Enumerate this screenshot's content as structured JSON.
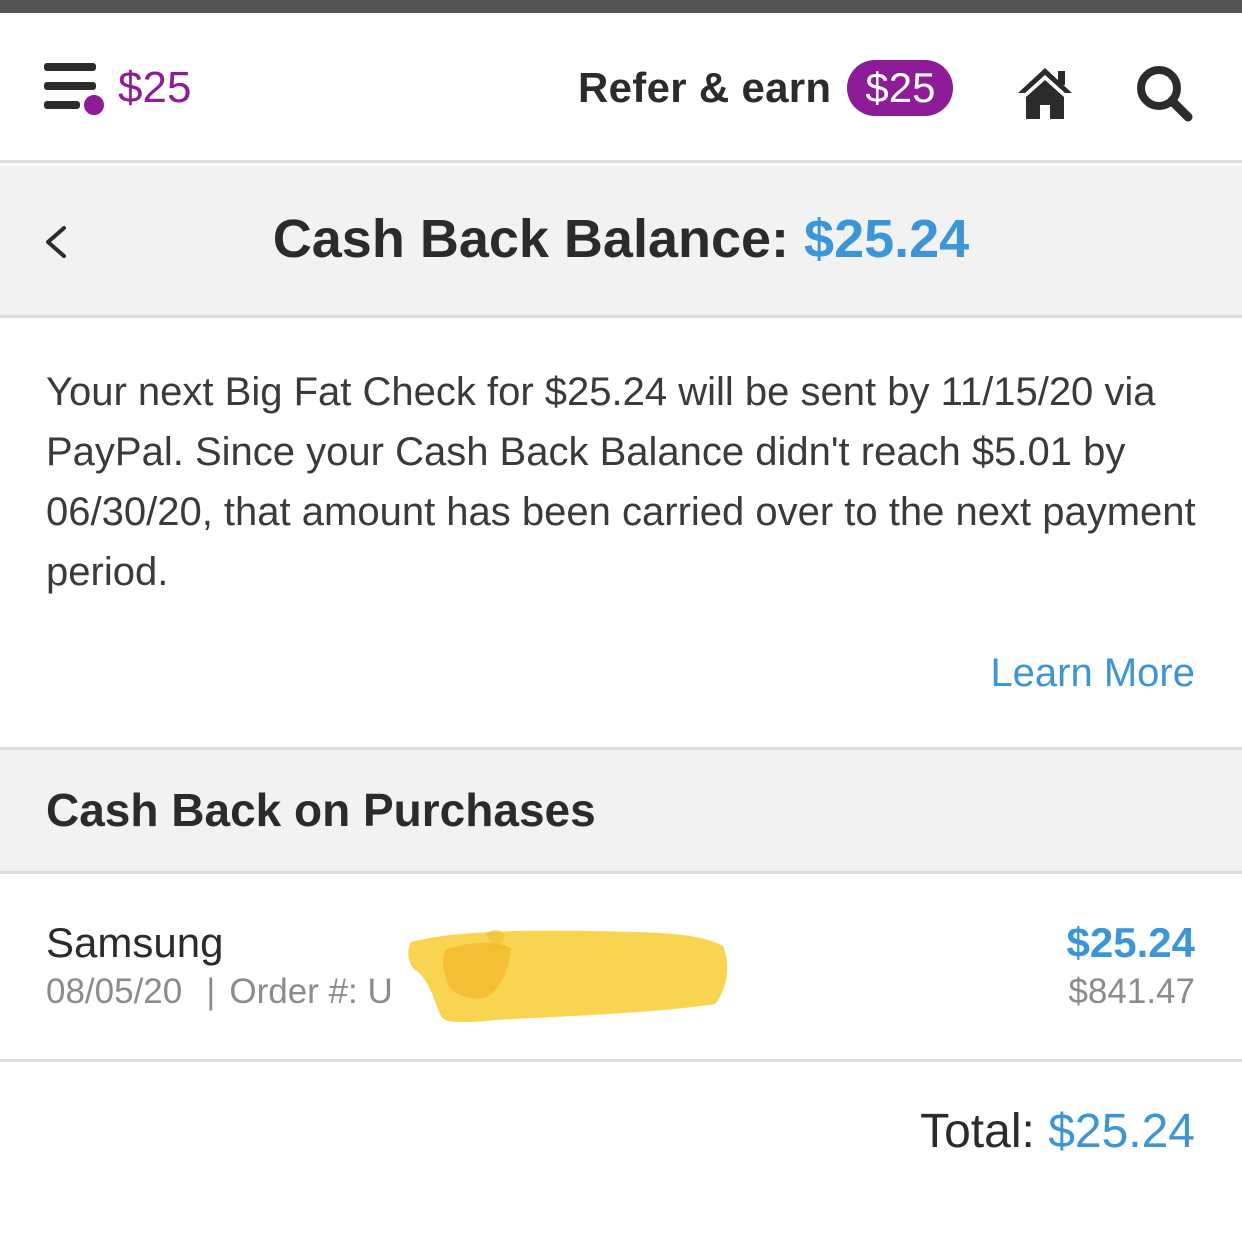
{
  "colors": {
    "brand_purple": "#8e1b97",
    "accent_blue": "#3b95d6",
    "header_gray": "#f2f2f2",
    "redaction_yellow": "#f7cf3d"
  },
  "nav": {
    "menu_icon": "hamburger-menu-icon",
    "balance": "$25",
    "refer_label": "Refer & earn",
    "refer_amount": "$25",
    "home_icon": "home-icon",
    "search_icon": "search-icon"
  },
  "header": {
    "back_icon": "chevron-left-icon",
    "title_label": "Cash Back Balance:",
    "title_amount": "$25.24"
  },
  "info": {
    "text": "Your next Big Fat Check for $25.24 will be sent by 11/15/20 via PayPal. Since your Cash Back Balance didn't reach $5.01 by 06/30/20, that amount has been carried over to the next payment period.",
    "learn_more": "Learn More"
  },
  "section": {
    "title": "Cash Back on Purchases"
  },
  "purchases": [
    {
      "store": "Samsung",
      "date": "08/05/20",
      "separator": "|",
      "order_label": "Order #: U",
      "cash_back": "$25.24",
      "purchase_amount": "$841.47"
    }
  ],
  "total": {
    "label": "Total:",
    "amount": "$25.24"
  }
}
